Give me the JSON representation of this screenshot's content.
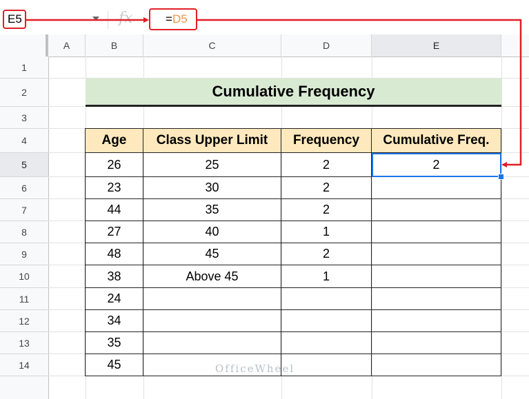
{
  "formula_bar": {
    "name_box": "E5",
    "fx_symbol": "fx",
    "formula_prefix": "=",
    "formula_ref": "D5"
  },
  "columns": [
    "A",
    "B",
    "C",
    "D",
    "E"
  ],
  "selected_column": "E",
  "rows": [
    "1",
    "2",
    "3",
    "4",
    "5",
    "6",
    "7",
    "8",
    "9",
    "10",
    "11",
    "12",
    "13",
    "14"
  ],
  "selected_row": "5",
  "title": "Cumulative Frequency",
  "table": {
    "headers": [
      "Age",
      "Class Upper Limit",
      "Frequency",
      "Cumulative Freq."
    ],
    "rows": [
      [
        "26",
        "25",
        "2",
        "2"
      ],
      [
        "23",
        "30",
        "2",
        ""
      ],
      [
        "44",
        "35",
        "2",
        ""
      ],
      [
        "27",
        "40",
        "1",
        ""
      ],
      [
        "48",
        "45",
        "2",
        ""
      ],
      [
        "38",
        "Above 45",
        "1",
        ""
      ],
      [
        "24",
        "",
        "",
        ""
      ],
      [
        "34",
        "",
        "",
        ""
      ],
      [
        "35",
        "",
        "",
        ""
      ],
      [
        "45",
        "",
        "",
        ""
      ]
    ]
  },
  "watermark": "OfficeWheel",
  "colors": {
    "annotation_red": "#e01e24",
    "selection_blue": "#1a73e8",
    "title_fill": "#d9ead3",
    "header_fill": "#fde9bd"
  }
}
